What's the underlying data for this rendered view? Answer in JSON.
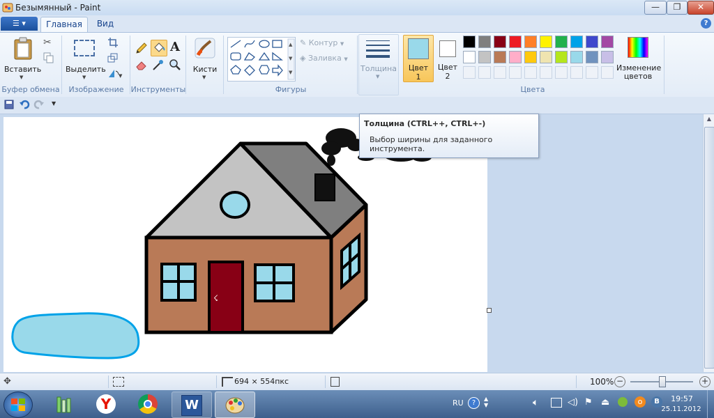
{
  "window": {
    "title": "Безымянный - Paint",
    "controls": {
      "minimize": "—",
      "maximize": "❐",
      "close": "✕"
    }
  },
  "tabs": {
    "file": "☰ ▾",
    "items": [
      "Главная",
      "Вид"
    ]
  },
  "ribbon": {
    "clipboard": {
      "paste": "Вставить",
      "label": "Буфер обмена"
    },
    "image": {
      "select": "Выделить",
      "label": "Изображение"
    },
    "tools": {
      "label": "Инструменты"
    },
    "brushes": {
      "label": "Кисти"
    },
    "shapes": {
      "outline": "Контур",
      "fill": "Заливка",
      "label": "Фигуры"
    },
    "thickness": {
      "label": "Толщина"
    },
    "color1": {
      "line1": "Цвет",
      "line2": "1",
      "value": "#99d9ea"
    },
    "color2": {
      "line1": "Цвет",
      "line2": "2",
      "value": "#ffffff"
    },
    "colors": {
      "label": "Цвета",
      "row1": [
        "#000000",
        "#7f7f7f",
        "#880015",
        "#ed1c24",
        "#ff7f27",
        "#fff200",
        "#22b14c",
        "#00a2e8",
        "#3f48cc",
        "#a349a4"
      ],
      "row2": [
        "#ffffff",
        "#c3c3c3",
        "#b97a57",
        "#ffaec9",
        "#ffc90e",
        "#efe4b0",
        "#b5e61d",
        "#99d9ea",
        "#7092be",
        "#c8bfe7"
      ]
    },
    "edit_colors": {
      "line1": "Изменение",
      "line2": "цветов"
    }
  },
  "tooltip": {
    "title": "Толщина (CTRL++, CTRL+-)",
    "body": "Выбор ширины для заданного инструмента."
  },
  "status": {
    "size": "694 × 554пкс",
    "zoom": "100%"
  },
  "taskbar": {
    "lang": "RU",
    "time": "19:57",
    "date": "25.11.2012"
  },
  "drawing": {
    "wall_color": "#b97a57",
    "roof_left": "#c3c3c3",
    "roof_right": "#7f7f7f",
    "window_color": "#99d9ea",
    "door_color": "#880015",
    "puddle_color": "#99d9ea",
    "puddle_outline": "#00a2e8"
  }
}
